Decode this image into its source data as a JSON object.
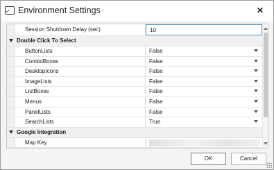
{
  "window": {
    "title": "Environment Settings",
    "close_glyph": "✕"
  },
  "grid": {
    "top_row": {
      "name": "Session Shutdown Delay (sec)",
      "value": "10"
    },
    "categories": [
      {
        "label": "Double Click To Select",
        "rows": [
          {
            "name": "ButtonLists",
            "value": "False"
          },
          {
            "name": "ComboBoxes",
            "value": "False"
          },
          {
            "name": "DesktopIcons",
            "value": "False"
          },
          {
            "name": "ImageLists",
            "value": "False"
          },
          {
            "name": "ListBoxes",
            "value": "False"
          },
          {
            "name": "Menus",
            "value": "False"
          },
          {
            "name": "PanelLists",
            "value": "False"
          },
          {
            "name": "SearchLists",
            "value": "True"
          }
        ]
      },
      {
        "label": "Google Integration",
        "rows": [
          {
            "name": "Map Key",
            "value": ""
          }
        ]
      }
    ]
  },
  "buttons": {
    "ok": "OK",
    "cancel": "Cancel"
  }
}
